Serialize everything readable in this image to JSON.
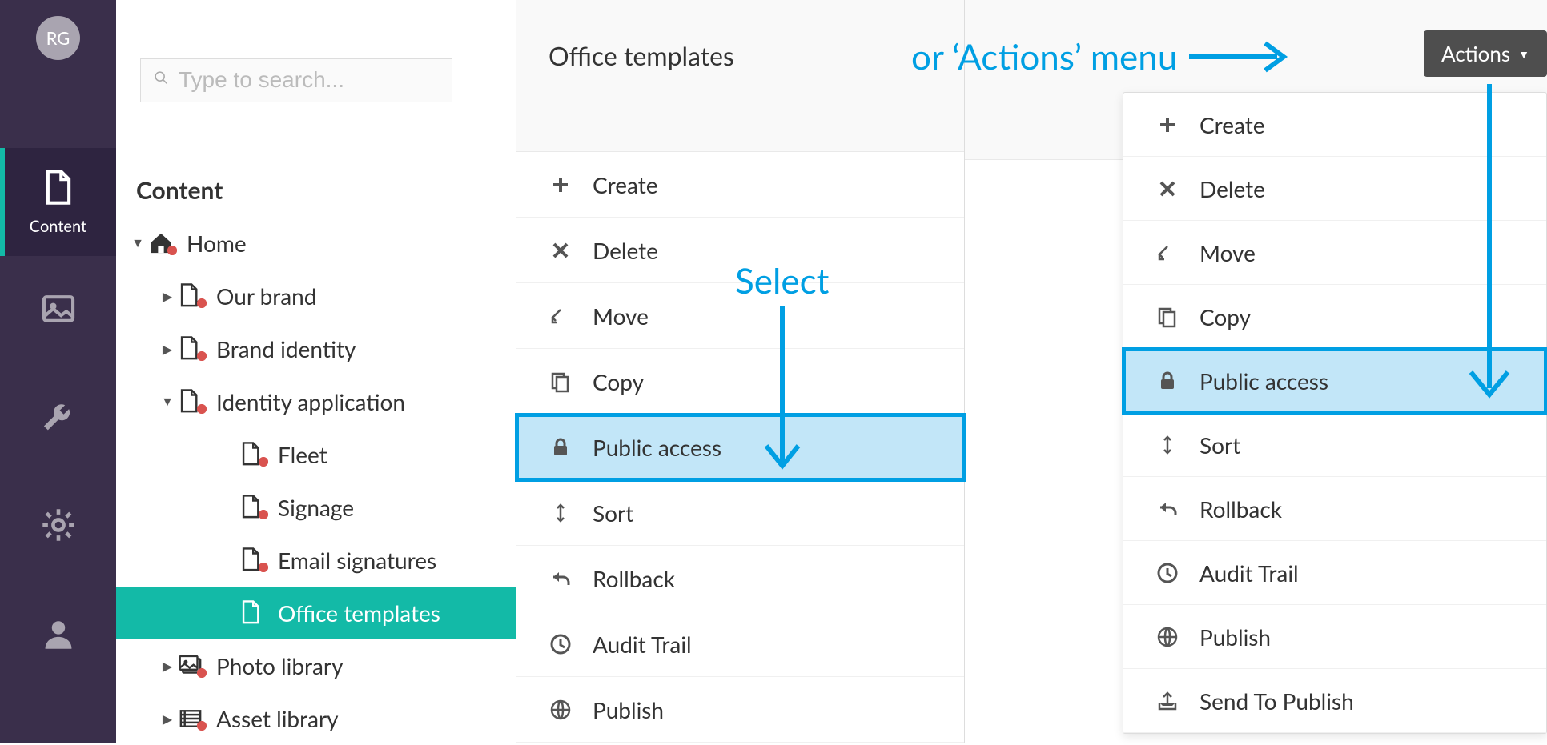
{
  "avatar": "RG",
  "search": {
    "placeholder": "Type to search..."
  },
  "iconbar": {
    "content_label": "Content"
  },
  "tree": {
    "heading": "Content",
    "home": "Home",
    "items": [
      {
        "label": "Our brand",
        "expandable": true
      },
      {
        "label": "Brand identity",
        "expandable": true
      },
      {
        "label": "Identity application",
        "expandable": true,
        "expanded": true
      },
      {
        "label": "Fleet",
        "child": true
      },
      {
        "label": "Signage",
        "child": true
      },
      {
        "label": "Email signatures",
        "child": true
      },
      {
        "label": "Office templates",
        "child": true,
        "selected": true
      },
      {
        "label": "Photo library",
        "expandable": true,
        "icon": "photos"
      },
      {
        "label": "Asset library",
        "expandable": true,
        "icon": "assets"
      }
    ]
  },
  "context_title": "Office templates",
  "context_menu": [
    {
      "icon": "plus",
      "label": "Create"
    },
    {
      "icon": "x",
      "label": "Delete"
    },
    {
      "icon": "move",
      "label": "Move"
    },
    {
      "icon": "copy",
      "label": "Copy"
    },
    {
      "icon": "lock",
      "label": "Public access",
      "highlight": true
    },
    {
      "icon": "sort",
      "label": "Sort"
    },
    {
      "icon": "rollback",
      "label": "Rollback"
    },
    {
      "icon": "clock",
      "label": "Audit Trail"
    },
    {
      "icon": "globe",
      "label": "Publish"
    }
  ],
  "actions_button": "Actions",
  "actions_menu": [
    {
      "icon": "plus",
      "label": "Create"
    },
    {
      "icon": "x",
      "label": "Delete"
    },
    {
      "icon": "move",
      "label": "Move"
    },
    {
      "icon": "copy",
      "label": "Copy"
    },
    {
      "icon": "lock",
      "label": "Public access",
      "highlight": true
    },
    {
      "icon": "sort",
      "label": "Sort"
    },
    {
      "icon": "rollback",
      "label": "Rollback"
    },
    {
      "icon": "clock",
      "label": "Audit Trail"
    },
    {
      "icon": "globe",
      "label": "Publish"
    },
    {
      "icon": "outbox",
      "label": "Send To Publish"
    }
  ],
  "annotations": {
    "select": "Select",
    "or_actions": "or ‘Actions’ menu"
  }
}
